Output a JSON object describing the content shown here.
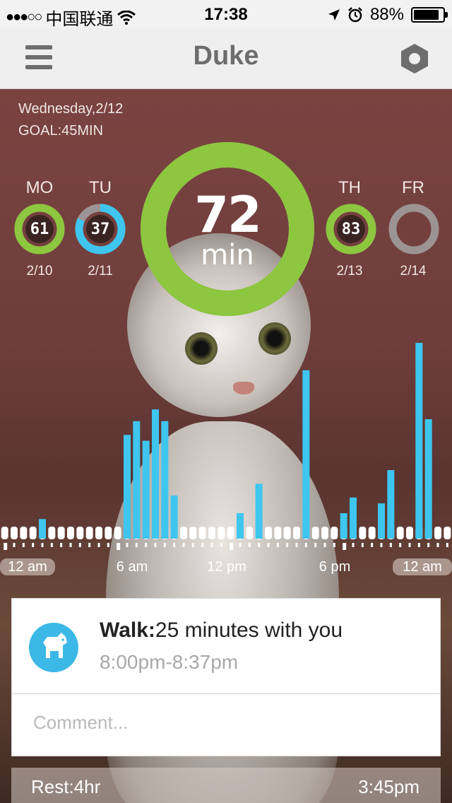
{
  "status_bar": {
    "carrier": "中国联通",
    "time": "17:38",
    "battery": "88%",
    "battery_level": 0.88
  },
  "nav": {
    "title": "Duke",
    "menu_icon": "hamburger-menu-icon",
    "settings_icon": "hexagon-settings-icon"
  },
  "summary": {
    "date": "Wednesday,2/12",
    "goal": "GOAL:45MIN",
    "today_value": "72",
    "today_unit": "min",
    "today_progress": 1.0
  },
  "days": [
    {
      "label": "MO",
      "value": "61",
      "date": "2/10",
      "progress": 1.0,
      "color": "#8dc63f"
    },
    {
      "label": "TU",
      "value": "37",
      "date": "2/11",
      "progress": 0.82,
      "color": "#3ec6ef"
    },
    {
      "label": "TH",
      "value": "83",
      "date": "2/13",
      "progress": 1.0,
      "color": "#8dc63f"
    },
    {
      "label": "FR",
      "value": "",
      "date": "2/14",
      "progress": 0,
      "color": "#9a9a9a"
    }
  ],
  "colors": {
    "green": "#8dc63f",
    "blue": "#3ec6ef",
    "track": "#9b9493"
  },
  "chart_data": {
    "type": "bar",
    "x_labels": [
      "12 am",
      "6 am",
      "12 pm",
      "6 pm",
      "12 am"
    ],
    "bins": 48,
    "values": [
      0,
      0,
      0,
      0,
      10,
      0,
      0,
      0,
      0,
      0,
      0,
      0,
      0,
      53,
      60,
      50,
      66,
      60,
      22,
      0,
      0,
      0,
      0,
      0,
      0,
      13,
      0,
      28,
      0,
      0,
      0,
      0,
      86,
      0,
      0,
      0,
      13,
      21,
      0,
      0,
      18,
      35,
      0,
      0,
      100,
      61,
      0,
      0
    ]
  },
  "activity": {
    "icon": "dog-icon",
    "type": "Walk:",
    "description": "25 minutes with you",
    "time_range": "8:00pm-8:37pm",
    "comment_placeholder": "Comment..."
  },
  "rest": {
    "label": "Rest:4hr",
    "time": "3:45pm"
  }
}
